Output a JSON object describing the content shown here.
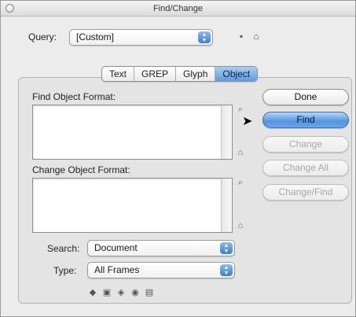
{
  "window": {
    "title": "Find/Change"
  },
  "query": {
    "label": "Query:",
    "value": "[Custom]",
    "save_icon": "save-query-icon",
    "delete_icon": "delete-query-icon"
  },
  "tabs": [
    {
      "label": "Text",
      "active": false
    },
    {
      "label": "GREP",
      "active": false
    },
    {
      "label": "Glyph",
      "active": false
    },
    {
      "label": "Object",
      "active": true
    }
  ],
  "find": {
    "label": "Find Object Format:",
    "value": ""
  },
  "change": {
    "label": "Change Object Format:",
    "value": ""
  },
  "buttons": {
    "done": "Done",
    "find": "Find",
    "change": "Change",
    "change_all": "Change All",
    "change_find": "Change/Find"
  },
  "search": {
    "label": "Search:",
    "value": "Document"
  },
  "type": {
    "label": "Type:",
    "value": "All Frames"
  },
  "icons": {
    "specify_find": "magnifier-format-icon",
    "clear_find": "trash-icon",
    "specify_change": "magnifier-format-icon",
    "clear_change": "trash-icon"
  },
  "colors": {
    "accent": "#5d9be2",
    "disabled_text": "#a6a6a6"
  }
}
